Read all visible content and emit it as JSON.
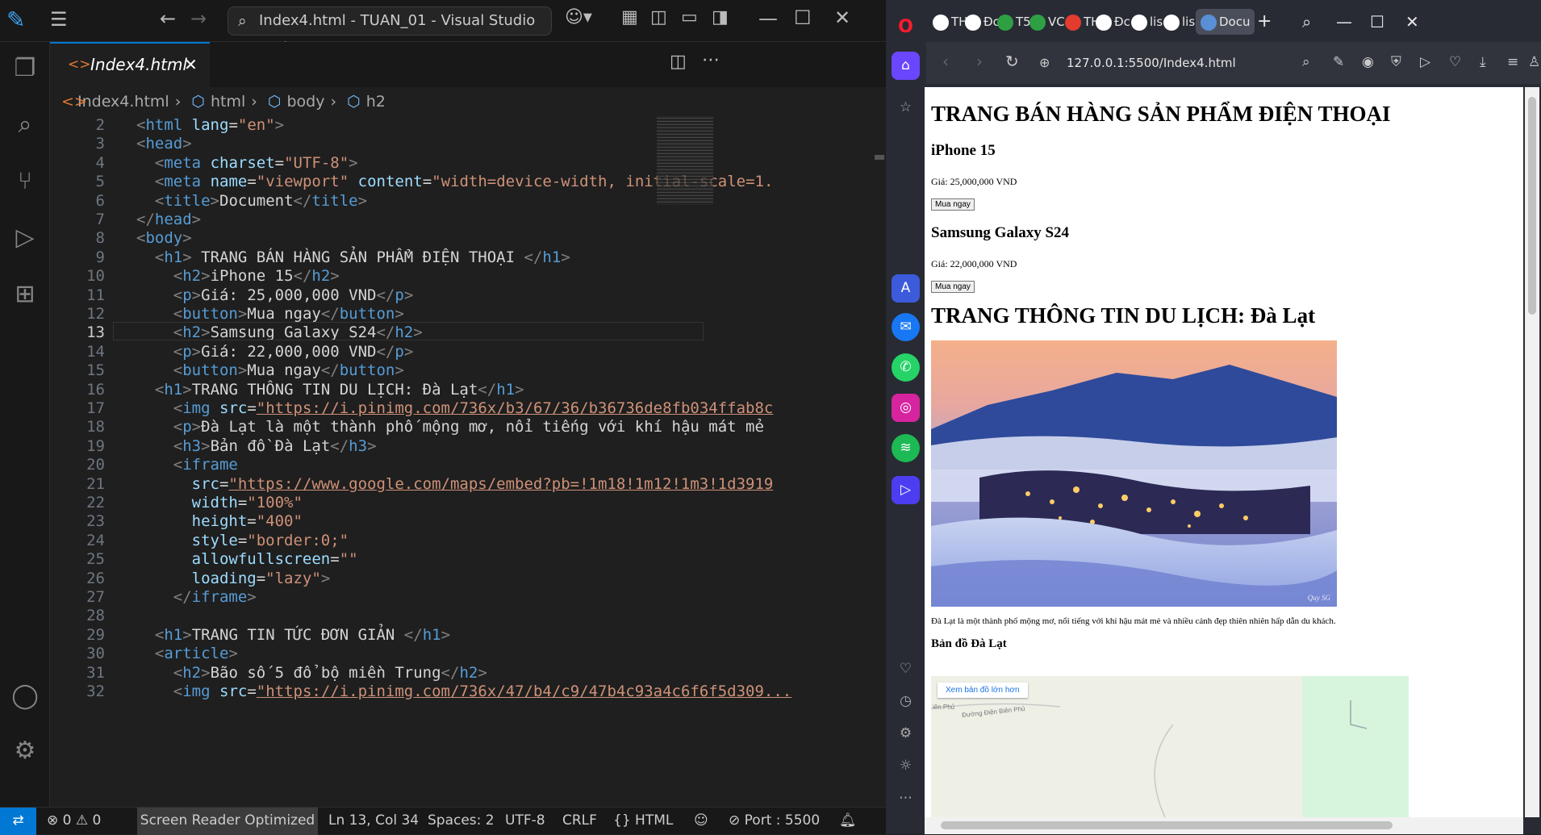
{
  "vscode": {
    "command_center": "Index4.html - TUAN_01 - Visual Studio Code",
    "tab": {
      "label": "Index4.html"
    },
    "breadcrumb": [
      "Index4.html",
      "html",
      "body",
      "h2"
    ],
    "status": {
      "problems": "0",
      "warnings": "0",
      "screen_reader": "Screen Reader Optimized",
      "position": "Ln 13, Col 34",
      "spaces": "Spaces: 2",
      "encoding": "UTF-8",
      "eol": "CRLF",
      "language": "HTML",
      "port": "Port : 5500"
    },
    "current_line": 13,
    "lines": [
      {
        "n": "2",
        "html": "<span class=t>&lt;</span><span class=tg>html</span> <span class=at>lang</span>=<span class=s>\"en\"</span><span class=t>&gt;</span>"
      },
      {
        "n": "3",
        "html": "<span class=t>&lt;</span><span class=tg>head</span><span class=t>&gt;</span>"
      },
      {
        "n": "4",
        "html": "  <span class=t>&lt;</span><span class=tg>meta</span> <span class=at>charset</span>=<span class=s>\"UTF-8\"</span><span class=t>&gt;</span>"
      },
      {
        "n": "5",
        "html": "  <span class=t>&lt;</span><span class=tg>meta</span> <span class=at>name</span>=<span class=s>\"viewport\"</span> <span class=at>content</span>=<span class=s>\"width=device-width, initial-scale=1.</span>"
      },
      {
        "n": "6",
        "html": "  <span class=t>&lt;</span><span class=tg>title</span><span class=t>&gt;</span>Document<span class=t>&lt;/</span><span class=tg>title</span><span class=t>&gt;</span>"
      },
      {
        "n": "7",
        "html": "<span class=t>&lt;/</span><span class=tg>head</span><span class=t>&gt;</span>"
      },
      {
        "n": "8",
        "html": "<span class=t>&lt;</span><span class=tg>body</span><span class=t>&gt;</span>"
      },
      {
        "n": "9",
        "html": "  <span class=t>&lt;</span><span class=tg>h1</span><span class=t>&gt;</span> TRANG BÁN HÀNG SẢN PHẨM ĐIỆN THOẠI <span class=t>&lt;/</span><span class=tg>h1</span><span class=t>&gt;</span>"
      },
      {
        "n": "10",
        "html": "    <span class=t>&lt;</span><span class=tg>h2</span><span class=t>&gt;</span>iPhone 15<span class=t>&lt;/</span><span class=tg>h2</span><span class=t>&gt;</span>"
      },
      {
        "n": "11",
        "html": "    <span class=t>&lt;</span><span class=tg>p</span><span class=t>&gt;</span>Giá: 25,000,000 VND<span class=t>&lt;/</span><span class=tg>p</span><span class=t>&gt;</span>"
      },
      {
        "n": "12",
        "html": "    <span class=t>&lt;</span><span class=tg>button</span><span class=t>&gt;</span>Mua ngay<span class=t>&lt;/</span><span class=tg>button</span><span class=t>&gt;</span>"
      },
      {
        "n": "13",
        "html": "    <span class=t>&lt;</span><span class=tg>h2</span><span class=t>&gt;</span>Samsung Galaxy S24<span class=t>&lt;/</span><span class=tg>h2</span><span class=t>&gt;</span>"
      },
      {
        "n": "14",
        "html": "    <span class=t>&lt;</span><span class=tg>p</span><span class=t>&gt;</span>Giá: 22,000,000 VND<span class=t>&lt;/</span><span class=tg>p</span><span class=t>&gt;</span>"
      },
      {
        "n": "15",
        "html": "    <span class=t>&lt;</span><span class=tg>button</span><span class=t>&gt;</span>Mua ngay<span class=t>&lt;/</span><span class=tg>button</span><span class=t>&gt;</span>"
      },
      {
        "n": "16",
        "html": "  <span class=t>&lt;</span><span class=tg>h1</span><span class=t>&gt;</span>TRANG THÔNG TIN DU LỊCH: Đà Lạt<span class=t>&lt;/</span><span class=tg>h1</span><span class=t>&gt;</span>"
      },
      {
        "n": "17",
        "html": "    <span class=t>&lt;</span><span class=tg>img</span> <span class=at>src</span>=<span class=u>\"https://i.pinimg.com/736x/b3/67/36/b36736de8fb034ffab8c</span>"
      },
      {
        "n": "18",
        "html": "    <span class=t>&lt;</span><span class=tg>p</span><span class=t>&gt;</span>Đà Lạt là một thành phố mộng mơ, nổi tiếng với khí hậu mát mẻ"
      },
      {
        "n": "19",
        "html": "    <span class=t>&lt;</span><span class=tg>h3</span><span class=t>&gt;</span>Bản đồ Đà Lạt<span class=t>&lt;/</span><span class=tg>h3</span><span class=t>&gt;</span>"
      },
      {
        "n": "20",
        "html": "    <span class=t>&lt;</span><span class=tg>iframe</span>"
      },
      {
        "n": "21",
        "html": "      <span class=at>src</span>=<span class=u>\"https://www.google.com/maps/embed?pb=!1m18!1m12!1m3!1d3919</span>"
      },
      {
        "n": "22",
        "html": "      <span class=at>width</span>=<span class=s>\"100%\"</span>"
      },
      {
        "n": "23",
        "html": "      <span class=at>height</span>=<span class=s>\"400\"</span>"
      },
      {
        "n": "24",
        "html": "      <span class=at>style</span>=<span class=s>\"border:0;\"</span>"
      },
      {
        "n": "25",
        "html": "      <span class=at>allowfullscreen</span>=<span class=s>\"\"</span>"
      },
      {
        "n": "26",
        "html": "      <span class=at>loading</span>=<span class=s>\"lazy\"</span><span class=t>&gt;</span>"
      },
      {
        "n": "27",
        "html": "    <span class=t>&lt;/</span><span class=tg>iframe</span><span class=t>&gt;</span>"
      },
      {
        "n": "28",
        "html": ""
      },
      {
        "n": "29",
        "html": "  <span class=t>&lt;</span><span class=tg>h1</span><span class=t>&gt;</span>TRANG TIN TỨC ĐƠN GIẢN <span class=t>&lt;/</span><span class=tg>h1</span><span class=t>&gt;</span>"
      },
      {
        "n": "30",
        "html": "  <span class=t>&lt;</span><span class=tg>article</span><span class=t>&gt;</span>"
      },
      {
        "n": "31",
        "html": "    <span class=t>&lt;</span><span class=tg>h2</span><span class=t>&gt;</span>Bão số 5 đổ bộ miền Trung<span class=t>&lt;/</span><span class=tg>h2</span><span class=t>&gt;</span>"
      },
      {
        "n": "32",
        "html": "    <span class=t>&lt;</span><span class=tg>img</span> <span class=at>src</span>=<span class=u>\"https://i.pinimg.com/736x/47/b4/c9/47b4c93a4c6f6f5d309...</span>"
      }
    ]
  },
  "browser": {
    "tabs": [
      "TH",
      "Đc",
      "T5",
      "VC",
      "TH",
      "Đc",
      "lis",
      "lis",
      "Docu"
    ],
    "tab_colors": [
      "#ffffff",
      "#ffffff",
      "#2ea043",
      "#2ea043",
      "#e33b2e",
      "#ffffff",
      "#ffffff",
      "#ffffff",
      "#5a8fd6"
    ],
    "url": "127.0.0.1:5500/Index4.html",
    "page": {
      "h1_shop": "TRANG BÁN HÀNG SẢN PHẨM ĐIỆN THOẠI",
      "p1_name": "iPhone 15",
      "p1_price": "Giá: 25,000,000 VND",
      "buy": "Mua ngay",
      "p2_name": "Samsung Galaxy S24",
      "p2_price": "Giá: 22,000,000 VND",
      "h1_travel": "TRANG THÔNG TIN DU LỊCH: Đà Lạt",
      "img_signature": "Quy SG",
      "desc": "Đà Lạt là một thành phố mộng mơ, nổi tiếng với khí hậu mát mẻ và nhiều cảnh đẹp thiên nhiên hấp dẫn du khách.",
      "h3_map": "Bản đồ Đà Lạt",
      "map_link": "Xem bản đồ lớn hơn",
      "map_street": "Đường Điện Biên Phủ",
      "map_street2": "iên Phủ"
    }
  }
}
